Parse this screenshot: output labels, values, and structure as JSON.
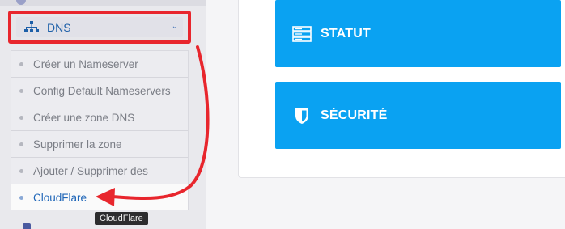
{
  "sidebar": {
    "dns_header": {
      "label": "DNS",
      "icon": "sitemap-icon",
      "chevron": "chevron-down-icon"
    },
    "items": [
      {
        "label": "Créer un Nameserver",
        "active": false
      },
      {
        "label": "Config Default Nameservers",
        "active": false
      },
      {
        "label": "Créer une zone DNS",
        "active": false
      },
      {
        "label": "Supprimer la zone",
        "active": false
      },
      {
        "label": "Ajouter / Supprimer des",
        "active": false
      },
      {
        "label": "CloudFlare",
        "active": true
      }
    ],
    "tooltip": "CloudFlare"
  },
  "tiles": [
    {
      "label": "STATUT",
      "icon": "server-icon"
    },
    {
      "label": "SÉCURITÉ",
      "icon": "shield-icon"
    }
  ],
  "colors": {
    "highlight": "#e8262d",
    "tile": "#0aa2f2",
    "active_link": "#1f66b8"
  }
}
